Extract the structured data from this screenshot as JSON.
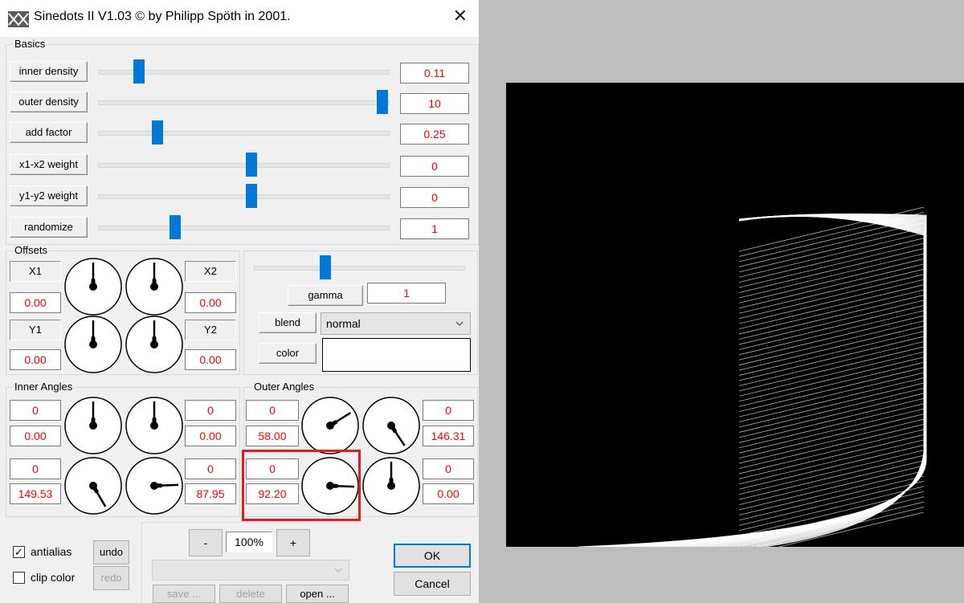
{
  "window": {
    "title": "Sinedots II V1.03 © by Philipp Spöth in 2001.",
    "close_glyph": "✕"
  },
  "basics": {
    "title": "Basics",
    "rows": [
      {
        "label": "inner density",
        "value": "0.11",
        "position": 0.07
      },
      {
        "label": "outer density",
        "value": "10",
        "position": 1.0
      },
      {
        "label": "add factor",
        "value": "0.25",
        "position": 0.14
      },
      {
        "label": "x1-x2 weight",
        "value": "0",
        "position": 0.5
      },
      {
        "label": "y1-y2 weight",
        "value": "0",
        "position": 0.5
      },
      {
        "label": "randomize",
        "value": "1",
        "position": 0.21
      }
    ]
  },
  "offsets": {
    "title": "Offsets",
    "x1": {
      "label": "X1",
      "value": "0.00"
    },
    "x2": {
      "label": "X2",
      "value": "0.00"
    },
    "y1": {
      "label": "Y1",
      "value": "0.00"
    },
    "y2": {
      "label": "Y2",
      "value": "0.00"
    },
    "dial_angles": [
      0,
      0,
      0,
      0
    ]
  },
  "display": {
    "gamma_label": "gamma",
    "gamma_value": "1",
    "gamma_position": 0.33,
    "blend_label": "blend",
    "blend_value": "normal",
    "color_label": "color",
    "color_value": "#ffffff"
  },
  "inner_angles": {
    "title": "Inner Angles",
    "left_top": {
      "count": "0",
      "value": "0.00"
    },
    "right_top": {
      "count": "0",
      "value": "0.00"
    },
    "left_bottom": {
      "count": "0",
      "value": "149.53"
    },
    "right_bottom": {
      "count": "0",
      "value": "87.95"
    },
    "dial_angles": [
      0,
      0,
      149.53,
      87.95
    ]
  },
  "outer_angles": {
    "title": "Outer Angles",
    "left_top": {
      "count": "0",
      "value": "58.00"
    },
    "right_top": {
      "count": "0",
      "value": "146.31"
    },
    "left_bottom": {
      "count": "0",
      "value": "92.20"
    },
    "right_bottom": {
      "count": "0",
      "value": "0.00"
    },
    "dial_angles": [
      58.0,
      146.31,
      92.2,
      0.0
    ]
  },
  "bottom": {
    "antialias_label": "antialias",
    "antialias_checked": true,
    "clip_color_label": "clip color",
    "clip_color_checked": false,
    "undo_label": "undo",
    "redo_label": "redo",
    "minus_label": "-",
    "zoom_value": "100%",
    "plus_label": "+",
    "preset_value": "",
    "save_label": "save ...",
    "delete_label": "delete",
    "open_label": "open ...",
    "ok_label": "OK",
    "cancel_label": "Cancel"
  },
  "preview": {
    "background": "#000000",
    "line_color": "#ffffff"
  }
}
